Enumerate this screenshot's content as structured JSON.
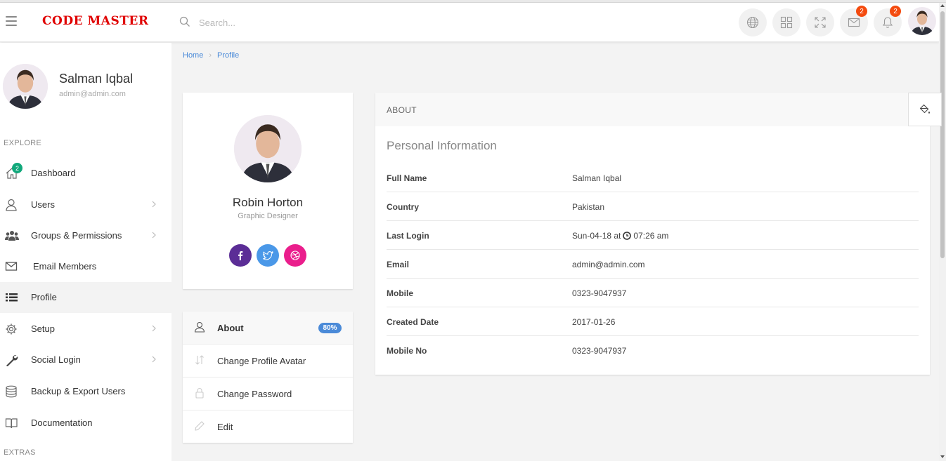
{
  "header": {
    "brand": "CODE MASTER",
    "search_placeholder": "Search...",
    "icons": [
      "globe-icon",
      "grid-icon",
      "fullscreen-icon",
      "mail-icon",
      "bell-icon"
    ],
    "mail_count": "2",
    "notification_count": "2"
  },
  "sidebar": {
    "user_name": "Salman Iqbal",
    "user_email": "admin@admin.com",
    "section_explore": "EXPLORE",
    "section_extras": "EXTRAS",
    "items": [
      {
        "label": "Dashboard",
        "icon": "home-icon",
        "badge": "2"
      },
      {
        "label": "Users",
        "icon": "user-icon"
      },
      {
        "label": "Groups & Permissions",
        "icon": "users-icon"
      },
      {
        "label": "Email Members",
        "icon": "envelope-icon"
      },
      {
        "label": "Profile",
        "icon": "list-icon"
      },
      {
        "label": "Setup",
        "icon": "gear-icon"
      },
      {
        "label": "Social Login",
        "icon": "wrench-icon"
      },
      {
        "label": "Backup & Export Users",
        "icon": "database-icon"
      },
      {
        "label": "Documentation",
        "icon": "book-icon"
      }
    ]
  },
  "breadcrumb": {
    "home": "Home",
    "current": "Profile"
  },
  "profile": {
    "name": "Robin Horton",
    "role": "Graphic Designer",
    "colors": {
      "facebook": "#5b2d96",
      "twitter": "#4a98e8",
      "dribbble": "#ea1e8c"
    }
  },
  "profile_menu": {
    "about": "About",
    "about_badge": "80%",
    "change_avatar": "Change Profile Avatar",
    "change_password": "Change Password",
    "edit": "Edit"
  },
  "about": {
    "header": "ABOUT",
    "section_title": "Personal Information",
    "rows": [
      {
        "label": "Full Name",
        "value": "Salman Iqbal"
      },
      {
        "label": "Country",
        "value": "Pakistan"
      },
      {
        "label": "Last Login",
        "value_prefix": "Sun-04-18 at",
        "value_suffix": "07:26 am"
      },
      {
        "label": "Email",
        "value": "admin@admin.com"
      },
      {
        "label": "Mobile",
        "value": "0323-9047937"
      },
      {
        "label": "Created Date",
        "value": "2017-01-26"
      },
      {
        "label": "Mobile No",
        "value": "0323-9047937"
      }
    ]
  }
}
